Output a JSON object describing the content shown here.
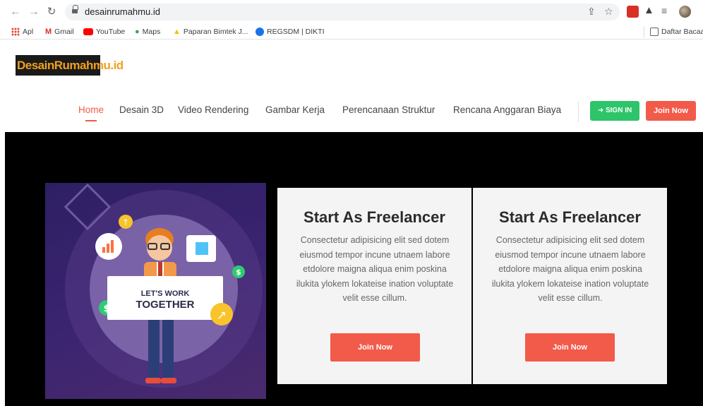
{
  "browser": {
    "url": "desainrumahmu.id",
    "bookmarks": [
      {
        "label": "Apl"
      },
      {
        "label": "Gmail"
      },
      {
        "label": "YouTube"
      },
      {
        "label": "Maps"
      },
      {
        "label": "Paparan Bimtek J..."
      },
      {
        "label": "REGSDM | DIKTI"
      }
    ],
    "reading_list": "Daftar Bacaa"
  },
  "site": {
    "logo": "DesainRumahmu.id",
    "nav": [
      {
        "label": "Home",
        "active": true
      },
      {
        "label": "Desain 3D"
      },
      {
        "label": "Video Rendering"
      },
      {
        "label": "Gambar Kerja"
      },
      {
        "label": "Perencanaan Struktur"
      },
      {
        "label": "Rencana Anggaran Biaya"
      }
    ],
    "signin_label": "SIGN IN",
    "join_label": "Join Now",
    "accent": "#f25a4a",
    "green": "#2ec46a"
  },
  "hero": {
    "illustration_text_1": "LET'S WORK",
    "illustration_text_2": "TOGETHER",
    "cards": [
      {
        "title": "Start As Freelancer",
        "text": "Consectetur adipisicing elit sed dotem eiusmod tempor incune utnaem labore etdolore maigna aliqua enim poskina ilukita ylokem lokateise ination voluptate velit esse cillum.",
        "button": "Join Now"
      },
      {
        "title": "Start As Freelancer",
        "text": "Consectetur adipisicing elit sed dotem eiusmod tempor incune utnaem labore etdolore maigna aliqua enim poskina ilukita ylokem lokateise ination voluptate velit esse cillum.",
        "button": "Join Now"
      }
    ]
  }
}
